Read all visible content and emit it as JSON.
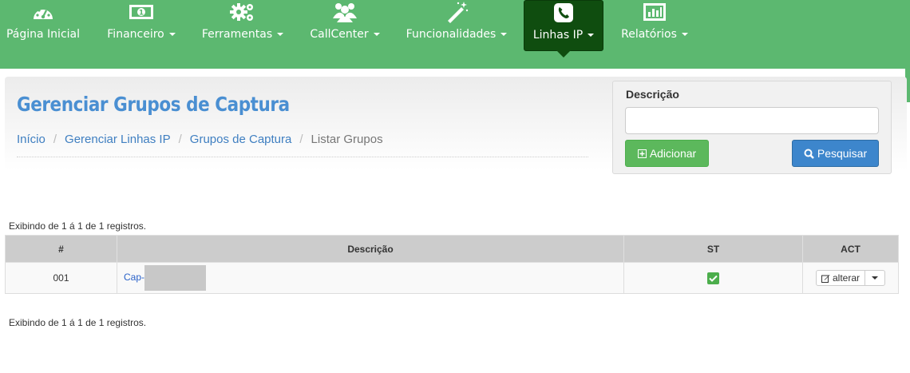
{
  "nav": {
    "items": [
      {
        "label": "Página Inicial",
        "icon": "dashboard-gauge-icon",
        "dropdown": false
      },
      {
        "label": "Financeiro",
        "icon": "money-bill-icon",
        "dropdown": true
      },
      {
        "label": "Ferramentas",
        "icon": "gears-icon",
        "dropdown": true
      },
      {
        "label": "CallCenter",
        "icon": "users-group-icon",
        "dropdown": true
      },
      {
        "label": "Funcionalidades",
        "icon": "magic-wand-icon",
        "dropdown": true
      },
      {
        "label": "Linhas IP",
        "icon": "phone-square-icon",
        "dropdown": true,
        "active": true
      },
      {
        "label": "Relatórios",
        "icon": "bar-chart-icon",
        "dropdown": true
      }
    ],
    "colors": {
      "bar": "#5cb870",
      "active": "#0f4d0f"
    }
  },
  "header": {
    "title": "Gerenciar Grupos de Captura",
    "breadcrumb": [
      "Início",
      "Gerenciar Linhas IP",
      "Grupos de Captura",
      "Listar Grupos"
    ]
  },
  "search": {
    "label": "Descrição",
    "value": "",
    "add_label": "Adicionar",
    "search_label": "Pesquisar"
  },
  "table": {
    "count_top": "Exibindo de 1 á 1 de 1 registros.",
    "count_bottom": "Exibindo de 1 á 1 de 1 registros.",
    "columns": [
      "#",
      "Descrição",
      "ST",
      "ACT"
    ],
    "rows": [
      {
        "id": "001",
        "description": "Cap-",
        "status": "active",
        "action_label": "alterar"
      }
    ]
  },
  "colors": {
    "title": "#4a8fd2",
    "link": "#3f7fc1",
    "add_button": "#5cb85c",
    "search_button": "#3d86cc",
    "status_ok": "#4cae4c"
  }
}
